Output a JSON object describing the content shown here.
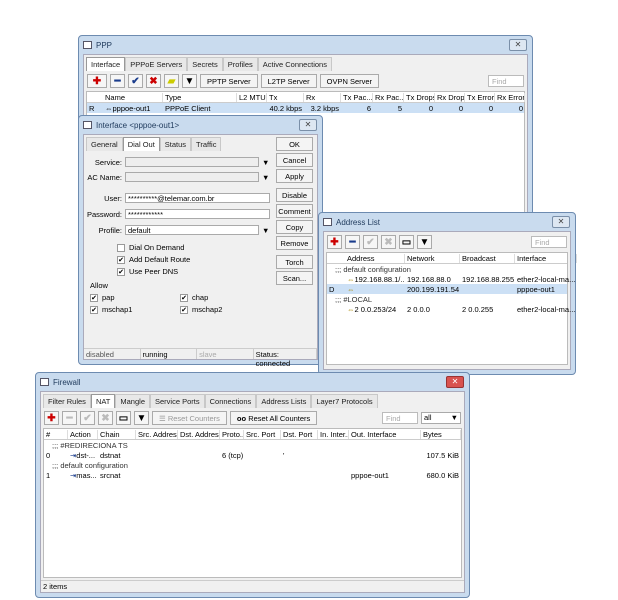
{
  "ppp": {
    "title": "PPP",
    "tabs": [
      "Interface",
      "PPPoE Servers",
      "Secrets",
      "Profiles",
      "Active Connections"
    ],
    "buttons": [
      "PPTP Server",
      "L2TP Server",
      "OVPN Server"
    ],
    "find": "Find",
    "columns": [
      "",
      "Name",
      "Type",
      "L2 MTU",
      "Tx",
      "Rx",
      "Tx Pac...",
      "Rx Pac...",
      "Tx Drops",
      "Rx Drops",
      "Tx Errors",
      "Rx Errors"
    ],
    "rows": [
      {
        "flag": "R",
        "name": "pppoe-out1",
        "type": "PPPoE Client",
        "l2mtu": "",
        "tx": "40.2 kbps",
        "rx": "3.2 kbps",
        "txp": "6",
        "rxp": "5",
        "txd": "0",
        "rxd": "0",
        "txe": "0",
        "rxe": "0"
      }
    ]
  },
  "iface": {
    "title": "Interface <pppoe-out1>",
    "tabs": [
      "General",
      "Dial Out",
      "Status",
      "Traffic"
    ],
    "service_label": "Service:",
    "ac_label": "AC Name:",
    "user_label": "User:",
    "user": "**********@telemar.com.br",
    "password_label": "Password:",
    "password": "************",
    "profile_label": "Profile:",
    "profile": "default",
    "dial_on_demand": "Dial On Demand",
    "add_default_route": "Add Default Route",
    "use_peer_dns": "Use Peer DNS",
    "allow": "Allow",
    "pap": "pap",
    "chap": "chap",
    "mschap1": "mschap1",
    "mschap2": "mschap2",
    "buttons": [
      "OK",
      "Cancel",
      "Apply",
      "Disable",
      "Comment",
      "Copy",
      "Remove",
      "Torch",
      "Scan..."
    ],
    "status": [
      "disabled",
      "running",
      "slave",
      "Status: connected"
    ]
  },
  "addr": {
    "title": "Address List",
    "find": "Find",
    "columns": [
      "",
      "Address",
      "Network",
      "Broadcast",
      "Interface"
    ],
    "rows": [
      {
        "comment": ";;; default configuration"
      },
      {
        "flag": "",
        "address": "192.168.88.1/...",
        "network": "192.168.88.0",
        "broadcast": "192.168.88.255",
        "iface": "ether2-local-ma..."
      },
      {
        "flag": "D",
        "address": "",
        "network": "200.199.191.54",
        "broadcast": "",
        "iface": "pppoe-out1",
        "sel": true
      },
      {
        "comment": ";;; #LOCAL"
      },
      {
        "flag": "",
        "address": "2    0.0.253/24",
        "network": "2    0.0.0",
        "broadcast": "2    0.0.255",
        "iface": "ether2-local-ma..."
      }
    ]
  },
  "fw": {
    "title": "Firewall",
    "tabs": [
      "Filter Rules",
      "NAT",
      "Mangle",
      "Service Ports",
      "Connections",
      "Address Lists",
      "Layer7 Protocols"
    ],
    "reset": "Reset Counters",
    "reset_all": "Reset All Counters",
    "find": "Find",
    "filter": "all",
    "columns": [
      "#",
      "Action",
      "Chain",
      "Src. Address",
      "Dst. Address",
      "Proto...",
      "Src. Port",
      "Dst. Port",
      "In. Inter...",
      "Out. Interface",
      "Bytes"
    ],
    "rows": [
      {
        "comment": ";;; #REDIRECIONA TS"
      },
      {
        "n": "0",
        "action": "dst-...",
        "chain": "dstnat",
        "proto": "6 (tcp)",
        "dport": "'",
        "out": "",
        "bytes": "107.5 KiB"
      },
      {
        "comment": ";;; default configuration"
      },
      {
        "n": "1",
        "action": "mas...",
        "chain": "srcnat",
        "proto": "",
        "dport": "",
        "out": "pppoe-out1",
        "bytes": "680.0 KiB"
      }
    ],
    "status": "2 items"
  }
}
